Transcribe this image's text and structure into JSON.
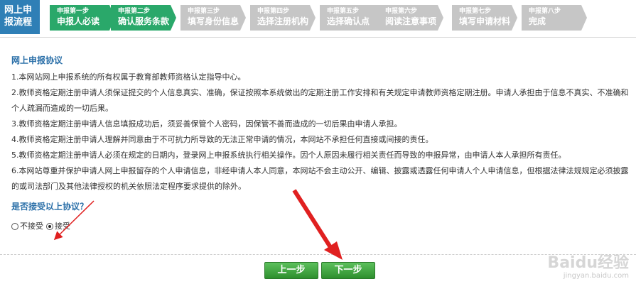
{
  "brand": {
    "line1": "网上申",
    "line2": "报流程"
  },
  "steps": [
    {
      "num": "申报第一步",
      "name": "申报人必读",
      "state": "done"
    },
    {
      "num": "申报第二步",
      "name": "确认服务条款",
      "state": "done"
    },
    {
      "num": "申报第三步",
      "name": "填写身份信息",
      "state": "todo"
    },
    {
      "num": "申报第四步",
      "name": "选择注册机构",
      "state": "todo"
    },
    {
      "num": "申报第五步",
      "name": "选择确认点",
      "state": "todo"
    },
    {
      "num": "申报第六步",
      "name": "阅读注意事项",
      "state": "todo"
    },
    {
      "num": "申报第七步",
      "name": "填写申请材料",
      "state": "todo"
    },
    {
      "num": "申报第八步",
      "name": "完成",
      "state": "todo"
    }
  ],
  "agreement": {
    "title": "网上申报协议",
    "items": [
      "1.本网站网上申报系统的所有权属于教育部教师资格认定指导中心。",
      "2.教师资格定期注册申请人须保证提交的个人信息真实、准确，保证按照本系统做出的定期注册工作安排和有关规定申请教师资格定期注册。申请人承担由于信息不真实、不准确和个人疏漏而造成的一切后果。",
      "3.教师资格定期注册申请人信息填报成功后，须妥善保管个人密码，因保管不善而造成的一切后果由申请人承担。",
      "4.教师资格定期注册申请人理解并同意由于不可抗力所导致的无法正常申请的情况，本网站不承担任何直接或间接的责任。",
      "5.教师资格定期注册申请人必须在规定的日期内，登录网上申报系统执行相关操作。因个人原因未履行相关责任而导致的申报异常，由申请人本人承担所有责任。",
      "6.本网站尊重并保护申请人网上申报留存的个人申请信息，非经申请人本人同意，本网站不会主动公开、编辑、披露或透露任何申请人个人申请信息，但根据法律法规规定必须披露的或司法部门及其他法律授权的机关依照法定程序要求提供的除外。"
    ]
  },
  "question": "是否接受以上协议？",
  "options": {
    "reject": "不接受",
    "accept": "接受",
    "selected": "accept"
  },
  "buttons": {
    "prev": "上一步",
    "next": "下一步"
  },
  "watermark": {
    "big": "Baidu经验",
    "small": "jingyan.baidu.com"
  },
  "colors": {
    "done": "#2aa86a",
    "todo": "#c6c6c6",
    "brand": "#2f7fb6",
    "arrow": "#e02020",
    "title": "#2a6fa8"
  }
}
